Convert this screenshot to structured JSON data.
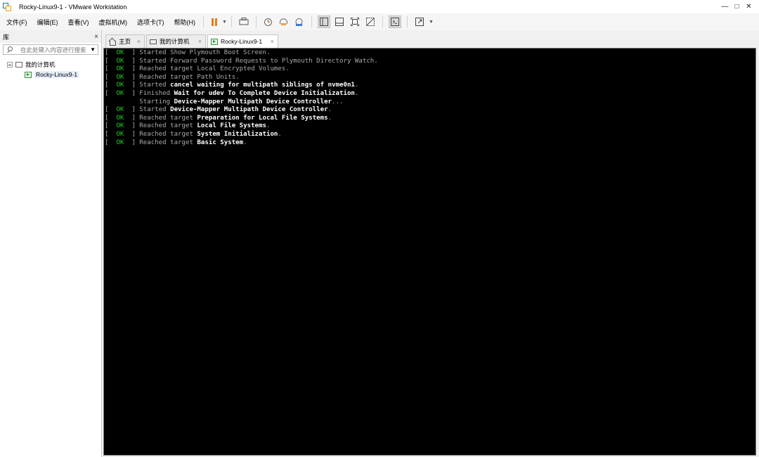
{
  "window": {
    "title": "Rocky-Linux9-1 - VMware Workstation",
    "controls": {
      "minimize": "—",
      "maximize": "□",
      "close": "✕"
    }
  },
  "menu": [
    "文件(F)",
    "编辑(E)",
    "查看(V)",
    "虚拟机(M)",
    "选项卡(T)",
    "帮助(H)"
  ],
  "toolbar": {
    "icons": [
      "pause-icon",
      "send-keys-icon",
      "snapshot-icon",
      "revert-snapshot-icon",
      "snapshot-manager-icon",
      "library-view-icon",
      "thumbnail-bar-icon",
      "fullscreen-icon",
      "unity-icon",
      "console-icon",
      "stretch-icon"
    ],
    "accent": "#f07a1a"
  },
  "library": {
    "title": "库",
    "close": "×",
    "search_placeholder": "在此处键入内容进行搜索",
    "tree": {
      "root": "我的计算机",
      "children": [
        "Rocky-Linux9-1"
      ]
    }
  },
  "tabs": [
    {
      "label": "主页",
      "close": "×",
      "icon": "home-icon"
    },
    {
      "label": "我的计算机",
      "close": "×",
      "icon": "monitor-icon"
    },
    {
      "label": "Rocky-Linux9-1",
      "close": "×",
      "icon": "vm-icon",
      "active": true
    }
  ],
  "console": {
    "ok_color": "#22cc22",
    "lines": [
      {
        "status": "OK",
        "pre": "Started ",
        "bold": "",
        "text": "Show Plymouth Boot Screen."
      },
      {
        "status": "OK",
        "pre": "Started ",
        "bold": "",
        "text": "Forward Password Requests to Plymouth Directory Watch."
      },
      {
        "status": "OK",
        "pre": "Reached target ",
        "bold": "",
        "text": "Local Encrypted Volumes."
      },
      {
        "status": "OK",
        "pre": "Reached target ",
        "bold": "",
        "text": "Path Units."
      },
      {
        "status": "OK",
        "pre": "Started ",
        "bold": "cancel waiting for multipath siblings of nvme0n1",
        "text": "."
      },
      {
        "status": "OK",
        "pre": "Finished ",
        "bold": "Wait for udev To Complete Device Initialization",
        "text": "."
      },
      {
        "status": "",
        "pre": "         Starting ",
        "bold": "Device-Mapper Multipath Device Controller",
        "text": "..."
      },
      {
        "status": "OK",
        "pre": "Started ",
        "bold": "Device-Mapper Multipath Device Controller",
        "text": "."
      },
      {
        "status": "OK",
        "pre": "Reached target ",
        "bold": "Preparation for Local File Systems",
        "text": "."
      },
      {
        "status": "OK",
        "pre": "Reached target ",
        "bold": "Local File Systems",
        "text": "."
      },
      {
        "status": "OK",
        "pre": "Reached target ",
        "bold": "System Initialization",
        "text": "."
      },
      {
        "status": "OK",
        "pre": "Reached target ",
        "bold": "Basic System",
        "text": "."
      }
    ]
  }
}
